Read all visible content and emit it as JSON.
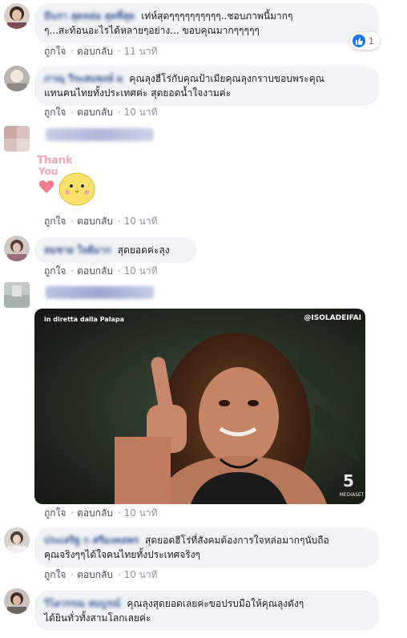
{
  "comments": [
    {
      "name": "มีนรา สุดหล่อ สุดที่สุด",
      "lines": [
        "เท่ห์สุดๆๆๆๆๆๆๆๆๆๆ..ชอบภาพนี้มากๆ",
        "ๆ...สะท้อนอะไรได้หลายๆอย่าง... ขอบคุณมากๆๆๆๆๆ"
      ],
      "like": "ถูกใจ",
      "reply": "ตอบกลับ",
      "time": "11 นาที",
      "reaction_count": "1"
    },
    {
      "name": "ภาณุ วีระสมพงษ์ ม",
      "lines": [
        "คุณลุงฮีโร่กับคุณป้าเมียคุณลุงกราบขอบพระคุณ",
        "แทนคนไทยทั้งประเทศค่ะ สุดยอดน้ำใจงามค่ะ"
      ],
      "like": "ถูกใจ",
      "reply": "ตอบกลับ",
      "time": "10 นาที"
    },
    {
      "sticker_text": "Thank You",
      "like": "ถูกใจ",
      "reply": "ตอบกลับ",
      "time": "10 นาที"
    },
    {
      "name": "สมชาย ใจดีมาก",
      "lines": [
        "สุดยอดค่ะลุง"
      ],
      "like": "ถูกใจ",
      "reply": "ตอบกลับ",
      "time": "10 นาที"
    },
    {
      "gif_caption": "in diretta dalla Palapa",
      "gif_tag": "@ISOLADEIFAI",
      "gif_logo": "5",
      "gif_logo_sub": "MEDIASET",
      "like": "ถูกใจ",
      "reply": "ตอบกลับ",
      "time": "10 นาที"
    },
    {
      "name": "ประเสริฐ ก ศรีมงคลพร",
      "lines": [
        "สุดยอดฮีโร่ที่สังคมต้องการใจหล่อมากๆนับถือ",
        "คุณจริงๆๆได้ใจคนไทยทั้งประเทศจริงๆ"
      ],
      "like": "ถูกใจ",
      "reply": "ตอบกลับ",
      "time": "10 นาที"
    },
    {
      "name": "วิไลวรรณ สมบูรณ์",
      "lines": [
        "คุณลุงสุดยอดเลยค่ะขอปรบมือให้คุณลุงดังๆ",
        "ได้ยินทั่วทั้งสามโลกเลยค่ะ"
      ]
    }
  ],
  "colors": {
    "bubble": "#f2f3f5",
    "name": "#385898",
    "meta": "#90949c",
    "like_badge": "#1877f2"
  }
}
